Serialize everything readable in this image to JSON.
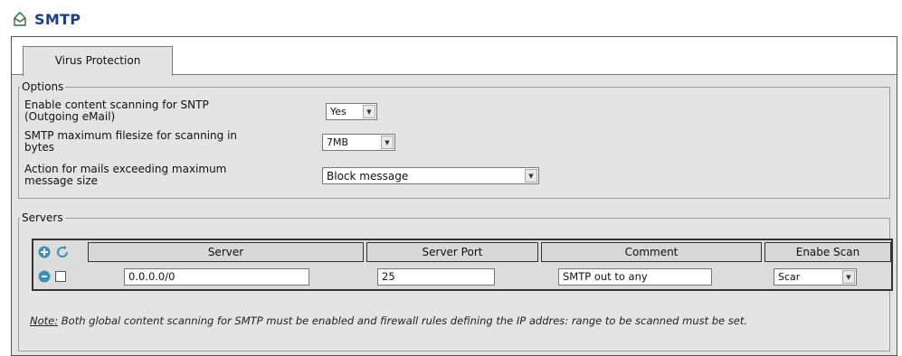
{
  "page": {
    "title": "SMTP"
  },
  "tabs": [
    {
      "label": "Virus Protection",
      "active": true
    }
  ],
  "options": {
    "legend": "Options",
    "enable_scanning": {
      "label_line1": "Enable content scanning for SNTP",
      "label_line2": "(Outgoing eMail)",
      "value": "Yes"
    },
    "max_filesize": {
      "label_line1": "SMTP maximum filesize for scanning in",
      "label_line2": "bytes",
      "value": "7MB"
    },
    "exceed_action": {
      "label_line1": "Action for mails exceeding maximum",
      "label_line2": "message size",
      "value": "Block message"
    }
  },
  "servers": {
    "legend": "Servers",
    "columns": {
      "server": "Server",
      "port": "Server Port",
      "comment": "Comment",
      "scan": "Enabe Scan"
    },
    "rows": [
      {
        "server": "0.0.0.0/0",
        "port": "25",
        "comment": "SMTP out to any",
        "scan": "Scar"
      }
    ]
  },
  "note": {
    "prefix": "Note:",
    "text": " Both global content scanning for SMTP must be enabled and firewall rules defining the IP addres: range to be scanned must be set."
  },
  "icons": {
    "title": "mail-clip-icon",
    "add": "add-row-icon",
    "refresh": "refresh-icon",
    "row": "row-edit-icon"
  },
  "colors": {
    "title": "#1a3f8a",
    "panel": "#e4e4e4",
    "icon_teal": "#3a8fb8"
  }
}
